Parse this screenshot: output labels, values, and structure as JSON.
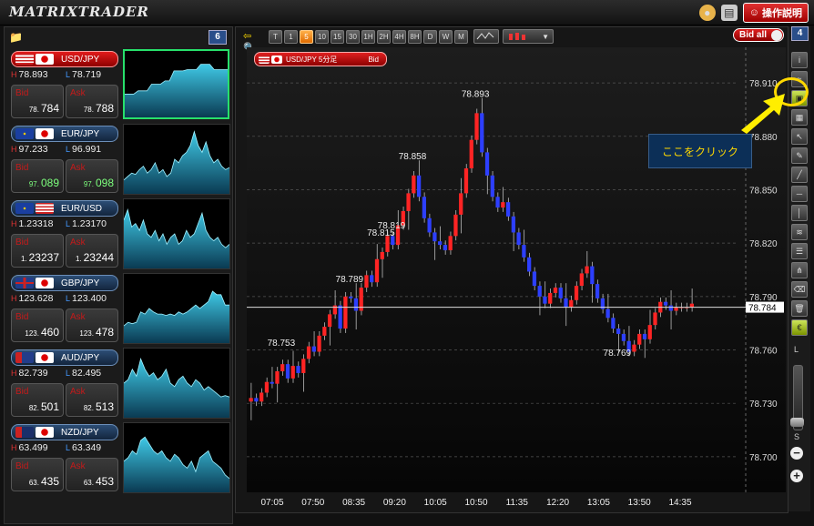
{
  "app": {
    "logo_text": "MATRIXTRADER",
    "help_label": "操作説明"
  },
  "left_panel": {
    "count": "6"
  },
  "pairs": [
    {
      "name": "USD/JPY",
      "active": true,
      "high": "78.893",
      "low": "78.719",
      "bid_pre": "78.",
      "bid_main": "784",
      "ask_pre": "78.",
      "ask_main": "788",
      "bid_label": "Bid",
      "ask_label": "Ask",
      "up": false,
      "spark": [
        0.35,
        0.35,
        0.35,
        0.4,
        0.4,
        0.4,
        0.5,
        0.5,
        0.5,
        0.55,
        0.55,
        0.7,
        0.7,
        0.7,
        0.72,
        0.72,
        0.72,
        0.8,
        0.8,
        0.8,
        0.72,
        0.72,
        0.72,
        0.72
      ]
    },
    {
      "name": "EUR/JPY",
      "active": false,
      "high": "97.233",
      "low": "96.991",
      "bid_pre": "97.",
      "bid_main": "089",
      "ask_pre": "97.",
      "ask_main": "098",
      "bid_label": "Bid",
      "ask_label": "Ask",
      "up": true,
      "spark": [
        0.2,
        0.25,
        0.3,
        0.28,
        0.35,
        0.4,
        0.3,
        0.35,
        0.45,
        0.3,
        0.35,
        0.25,
        0.3,
        0.5,
        0.45,
        0.55,
        0.6,
        0.7,
        0.9,
        0.7,
        0.6,
        0.75,
        0.55,
        0.45,
        0.5,
        0.4,
        0.35,
        0.38
      ]
    },
    {
      "name": "EUR/USD",
      "active": false,
      "high": "1.23318",
      "low": "1.23170",
      "bid_pre": "1.",
      "bid_main": "23237",
      "ask_pre": "1.",
      "ask_main": "23244",
      "bid_label": "Bid",
      "ask_label": "Ask",
      "up": false,
      "spark": [
        0.7,
        0.85,
        0.6,
        0.65,
        0.55,
        0.7,
        0.5,
        0.45,
        0.55,
        0.4,
        0.5,
        0.35,
        0.45,
        0.5,
        0.35,
        0.4,
        0.55,
        0.45,
        0.5,
        0.65,
        0.8,
        0.55,
        0.45,
        0.4,
        0.45,
        0.35,
        0.3,
        0.35
      ]
    },
    {
      "name": "GBP/JPY",
      "active": false,
      "high": "123.628",
      "low": "123.400",
      "bid_pre": "123.",
      "bid_main": "460",
      "ask_pre": "123.",
      "ask_main": "478",
      "bid_label": "Bid",
      "ask_label": "Ask",
      "up": false,
      "spark": [
        0.25,
        0.3,
        0.28,
        0.3,
        0.45,
        0.42,
        0.5,
        0.45,
        0.42,
        0.42,
        0.4,
        0.42,
        0.4,
        0.45,
        0.42,
        0.45,
        0.5,
        0.55,
        0.5,
        0.55,
        0.6,
        0.75,
        0.7,
        0.7,
        0.55,
        0.55
      ]
    },
    {
      "name": "AUD/JPY",
      "active": false,
      "high": "82.739",
      "low": "82.495",
      "bid_pre": "82.",
      "bid_main": "501",
      "ask_pre": "82.",
      "ask_main": "513",
      "bid_label": "Bid",
      "ask_label": "Ask",
      "up": false,
      "spark": [
        0.5,
        0.55,
        0.7,
        0.6,
        0.85,
        0.7,
        0.6,
        0.65,
        0.55,
        0.6,
        0.7,
        0.5,
        0.45,
        0.55,
        0.6,
        0.5,
        0.45,
        0.55,
        0.5,
        0.4,
        0.45,
        0.4,
        0.35,
        0.3,
        0.32,
        0.3
      ]
    },
    {
      "name": "NZD/JPY",
      "active": false,
      "high": "63.499",
      "low": "63.349",
      "bid_pre": "63.",
      "bid_main": "435",
      "ask_pre": "63.",
      "ask_main": "453",
      "bid_label": "Bid",
      "ask_label": "Ask",
      "up": false,
      "spark": [
        0.45,
        0.5,
        0.6,
        0.55,
        0.75,
        0.8,
        0.7,
        0.6,
        0.55,
        0.6,
        0.5,
        0.45,
        0.55,
        0.5,
        0.4,
        0.35,
        0.45,
        0.3,
        0.5,
        0.55,
        0.6,
        0.45,
        0.4,
        0.35,
        0.25,
        0.2
      ]
    }
  ],
  "toolbar": {
    "timeframes": [
      "T",
      "1",
      "5",
      "10",
      "15",
      "30",
      "1H",
      "2H",
      "4H",
      "8H",
      "D",
      "W",
      "M"
    ],
    "selected": "5",
    "bid_all_label": "Bid all"
  },
  "chart_tag": {
    "label": "USD/JPY 5分足",
    "side": "Bid"
  },
  "chart_data": {
    "type": "candlestick",
    "symbol": "USD/JPY",
    "timeframe": "5分足",
    "price_type": "Bid",
    "ylim": [
      78.68,
      78.93
    ],
    "y_ticks": [
      "78.910",
      "78.880",
      "78.850",
      "78.820",
      "78.790",
      "78.760",
      "78.730",
      "78.700"
    ],
    "x_ticks": [
      "07:05",
      "07:50",
      "08:35",
      "09:20",
      "10:05",
      "10:50",
      "11:35",
      "12:20",
      "13:05",
      "13:50",
      "14:35"
    ],
    "current_price": "78.784",
    "annotations": [
      {
        "text": "78.893",
        "value": 78.893
      },
      {
        "text": "78.858",
        "value": 78.858
      },
      {
        "text": "78.815",
        "value": 78.815
      },
      {
        "text": "78.819",
        "value": 78.819
      },
      {
        "text": "78.769",
        "value": 78.769
      },
      {
        "text": "78.789",
        "value": 78.789
      },
      {
        "text": "78.753",
        "value": 78.753
      }
    ],
    "candles_note": "approx close series",
    "closes": [
      78.733,
      78.731,
      78.736,
      78.742,
      78.741,
      78.748,
      78.752,
      78.744,
      78.751,
      78.747,
      78.755,
      78.762,
      78.759,
      78.768,
      78.773,
      78.78,
      78.785,
      78.772,
      78.79,
      78.789,
      78.782,
      78.795,
      78.802,
      78.798,
      78.811,
      78.815,
      78.824,
      78.819,
      78.83,
      78.838,
      78.848,
      78.858,
      78.846,
      78.834,
      78.826,
      78.821,
      78.819,
      78.816,
      78.824,
      78.836,
      78.848,
      78.862,
      78.878,
      78.893,
      78.871,
      78.858,
      78.846,
      78.84,
      78.843,
      78.835,
      78.826,
      78.819,
      78.812,
      78.804,
      78.796,
      78.79,
      78.786,
      78.792,
      78.795,
      78.789,
      78.784,
      78.788,
      78.796,
      78.803,
      78.807,
      78.797,
      78.789,
      78.783,
      78.778,
      78.772,
      78.769,
      78.765,
      78.759,
      78.763,
      78.769,
      78.766,
      78.774,
      78.781,
      78.787,
      78.785,
      78.782,
      78.784,
      78.784,
      78.784,
      78.786
    ]
  },
  "callout": {
    "text": "ここをクリック"
  },
  "right_toolbar": {
    "count": "4",
    "zoom_large": "L",
    "zoom_small": "S"
  }
}
